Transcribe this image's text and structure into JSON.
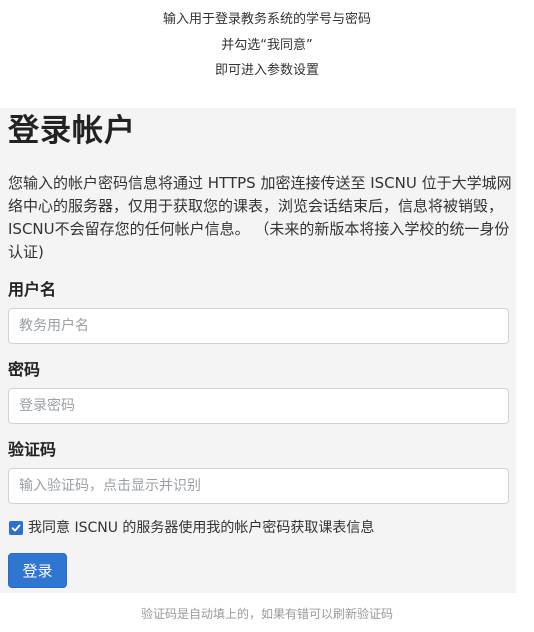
{
  "instructions": {
    "line1": "输入用于登录教务系统的学号与密码",
    "line2": "并勾选“我同意”",
    "line3": "即可进入参数设置"
  },
  "form": {
    "title": "登录帐户",
    "description": "您输入的帐户密码信息将通过 HTTPS 加密连接传送至 ISCNU 位于大学城网络中心的服务器，仅用于获取您的课表，浏览会话结束后，信息将被销毁，ISCNU不会留存您的任何帐户信息。 （未来的新版本将接入学校的统一身份认证)",
    "username": {
      "label": "用户名",
      "placeholder": "教务用户名",
      "value": ""
    },
    "password": {
      "label": "密码",
      "placeholder": "登录密码",
      "value": ""
    },
    "captcha": {
      "label": "验证码",
      "placeholder": "输入验证码，点击显示并识别",
      "value": ""
    },
    "agree": {
      "checked": true,
      "label": "我同意 ISCNU 的服务器使用我的帐户密码获取课表信息"
    },
    "submit_label": "登录"
  },
  "footer_note": "验证码是自动填上的，如果有错可以刷新验证码",
  "colors": {
    "primary": "#2f76d2",
    "panel_bg": "#f4f4f5"
  }
}
